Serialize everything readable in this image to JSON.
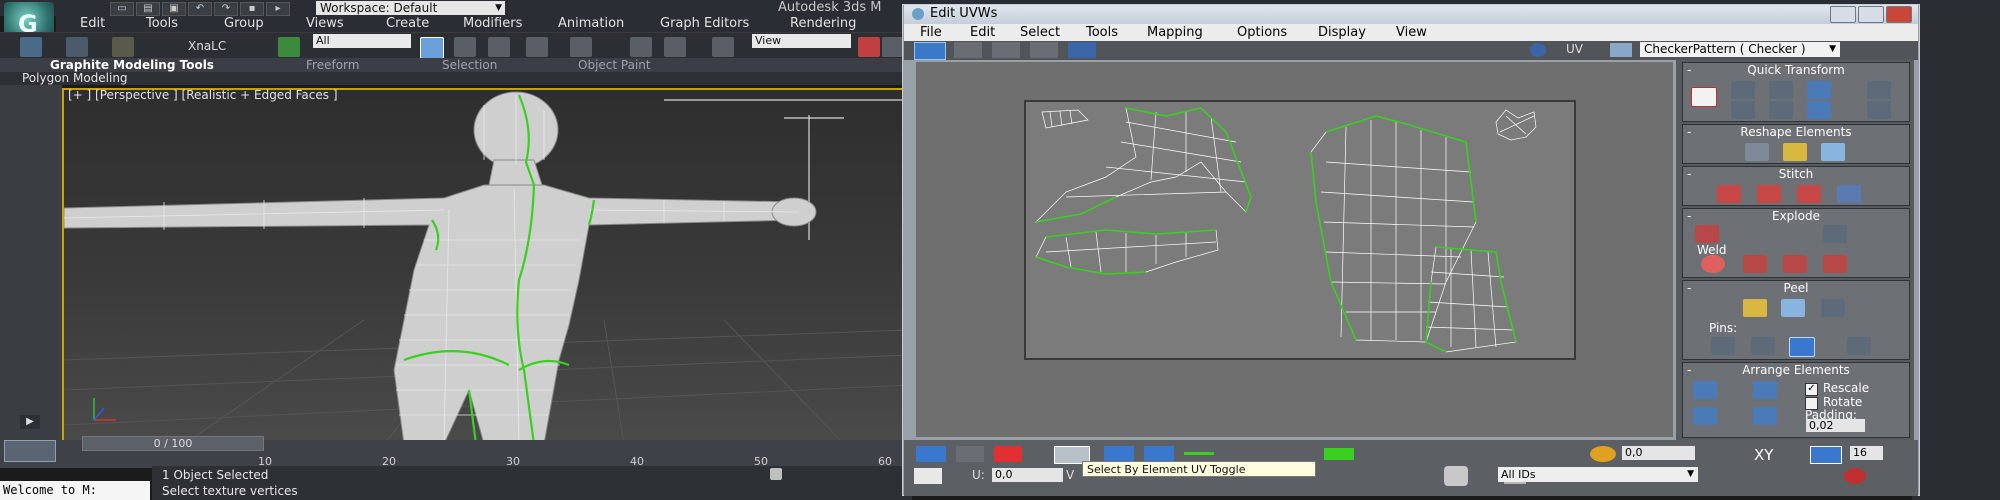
{
  "max": {
    "workspace": "Workspace: Default",
    "title": "Autodesk 3ds M",
    "menus": [
      "Edit",
      "Tools",
      "Group",
      "Views",
      "Create",
      "Modifiers",
      "Animation",
      "Graph Editors",
      "Rendering"
    ],
    "toolbar_label": "XnaLC",
    "selection_filter": "All",
    "ref_coord": "View",
    "ribbon_tabs": [
      "Graphite Modeling Tools",
      "Freeform",
      "Selection",
      "Object Paint"
    ],
    "ribbon_panel": "Polygon Modeling",
    "viewport_label": "[+ ] [Perspective ] [Realistic + Edged Faces ]",
    "time_slider": "0 / 100",
    "timeline_ticks": [
      "10",
      "20",
      "30",
      "40",
      "50",
      "60"
    ],
    "maxscript": "Welcome to M:",
    "status_selected": "1 Object Selected",
    "status_prompt": "Select texture vertices"
  },
  "uvw": {
    "title": "Edit UVWs",
    "menus": [
      "File",
      "Edit",
      "Select",
      "Tools",
      "Mapping",
      "Options",
      "Display",
      "View"
    ],
    "uv_label": "UV",
    "checker": "CheckerPattern  ( Checker )",
    "u_label": "U:",
    "u_value": "0,0",
    "v_label": "V",
    "tooltip": "Select By Element UV Toggle",
    "ids_dropdown": "All IDs",
    "bottom_value": "0,0",
    "xy_label": "XY",
    "grid_value": "16"
  },
  "rollouts": {
    "quick_transform": "Quick Transform",
    "reshape": "Reshape Elements",
    "stitch": "Stitch",
    "explode": "Explode",
    "weld": "Weld",
    "peel": "Peel",
    "pins": "Pins:",
    "arrange": "Arrange Elements",
    "rescale": "Rescale",
    "rotate": "Rotate",
    "padding_label": "Padding:",
    "padding_value": "0,02"
  },
  "colors": {
    "accent_green": "#39d020",
    "viewport_border": "#c8a300",
    "selection_red": "#e03030"
  }
}
